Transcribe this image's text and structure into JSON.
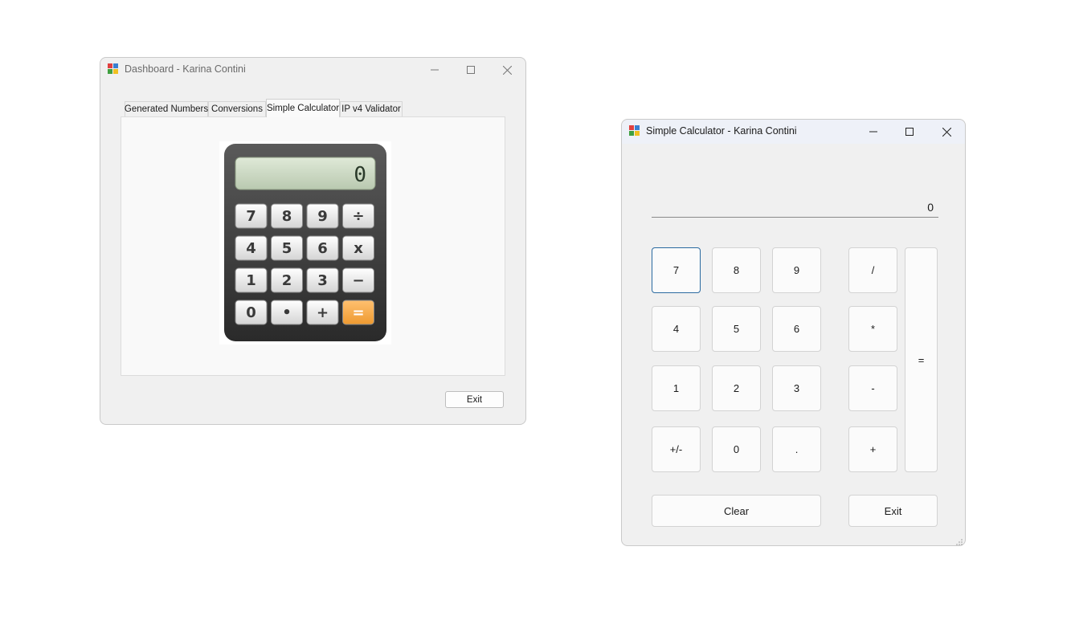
{
  "dashboard": {
    "title": "Dashboard - Karina Contini",
    "tabs": [
      {
        "label": "Generated Numbers"
      },
      {
        "label": "Conversions"
      },
      {
        "label": "Simple Calculator"
      },
      {
        "label": "IP v4 Validator"
      }
    ],
    "active_tab": "Simple Calculator",
    "exit_label": "Exit",
    "calculator_image": {
      "icon": "calculator-illustration",
      "screen_digit": "0",
      "keys": [
        [
          "7",
          "8",
          "9",
          "÷"
        ],
        [
          "4",
          "5",
          "6",
          "x"
        ],
        [
          "1",
          "2",
          "3",
          "−"
        ],
        [
          "0",
          "•",
          "+",
          "="
        ]
      ]
    }
  },
  "calculator": {
    "title": "Simple Calculator - Karina Contini",
    "display_value": "0",
    "buttons": {
      "b7": "7",
      "b8": "8",
      "b9": "9",
      "div": "/",
      "b4": "4",
      "b5": "5",
      "b6": "6",
      "mul": "*",
      "b1": "1",
      "b2": "2",
      "b3": "3",
      "sub": "-",
      "neg": "+/-",
      "b0": "0",
      "dot": ".",
      "add": "+",
      "eq": "=",
      "clear": "Clear",
      "exit": "Exit"
    }
  },
  "colors": {
    "window_bg": "#f0f0f0",
    "focus_border": "#2b6aa0",
    "equals_key": "#f0a040"
  }
}
